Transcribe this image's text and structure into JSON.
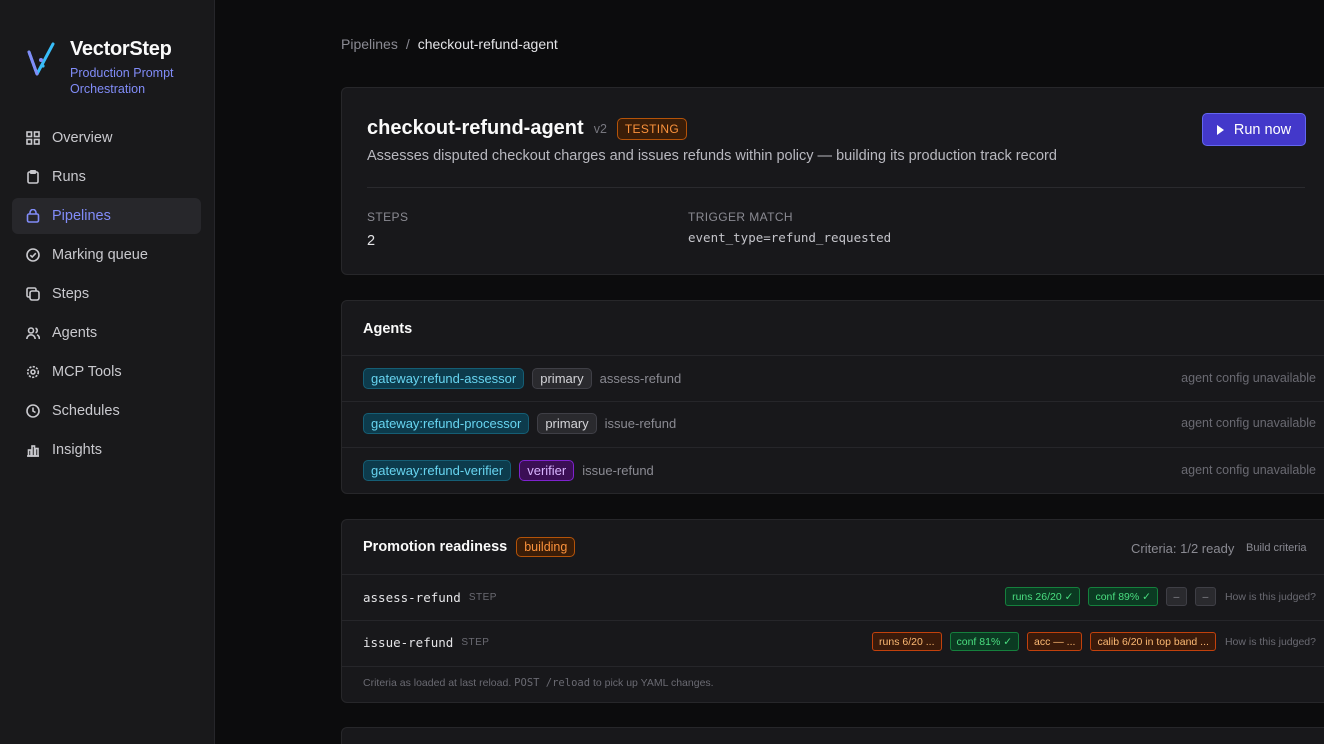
{
  "brand": {
    "name": "VectorStep",
    "tagline_line1": "Production Prompt",
    "tagline_line2": "Orchestration",
    "accent": "#818cf8"
  },
  "nav": [
    {
      "label": "Overview",
      "icon": "grid-icon"
    },
    {
      "label": "Runs",
      "icon": "clipboard-icon"
    },
    {
      "label": "Pipelines",
      "icon": "bag-icon",
      "active": true
    },
    {
      "label": "Marking queue",
      "icon": "check-circle-icon"
    },
    {
      "label": "Steps",
      "icon": "copy-icon"
    },
    {
      "label": "Agents",
      "icon": "users-icon"
    },
    {
      "label": "MCP Tools",
      "icon": "gear-icon"
    },
    {
      "label": "Schedules",
      "icon": "clock-icon"
    },
    {
      "label": "Insights",
      "icon": "bar-chart-icon"
    }
  ],
  "breadcrumb": {
    "parent": "Pipelines",
    "separator": "/",
    "current": "checkout-refund-agent"
  },
  "pipeline": {
    "name": "checkout-refund-agent",
    "version": "v2",
    "status": "TESTING",
    "description": "Assesses disputed checkout charges and issues refunds within policy — building its production track record",
    "run_label": "Run now",
    "steps_label": "STEPS",
    "steps_value": "2",
    "trigger_label": "TRIGGER MATCH",
    "trigger_value": "event_type=refund_requested"
  },
  "agents": {
    "title": "Agents",
    "rows": [
      {
        "gateway": "gateway:refund-assessor",
        "role": "primary",
        "step": "assess-refund",
        "status": "agent config unavailable"
      },
      {
        "gateway": "gateway:refund-processor",
        "role": "primary",
        "step": "issue-refund",
        "status": "agent config unavailable"
      },
      {
        "gateway": "gateway:refund-verifier",
        "role": "verifier",
        "step": "issue-refund",
        "status": "agent config unavailable"
      }
    ]
  },
  "promotion": {
    "title": "Promotion readiness",
    "status": "building",
    "criteria_ready": "Criteria: 1/2 ready",
    "build_criteria": "Build criteria",
    "how_label": "How is this judged?",
    "step_tag": "STEP",
    "steps": [
      {
        "name": "assess-refund",
        "pills": [
          "runs 26/20 ✓",
          "conf 89% ✓",
          "–",
          "–"
        ]
      },
      {
        "name": "issue-refund",
        "pills": [
          "runs 6/20 ...",
          "conf 81% ✓",
          "acc — ...",
          "calib 6/20 in top band ..."
        ]
      }
    ],
    "footnote_pre": "Criteria as loaded at last reload.",
    "footnote_code": "POST /reload",
    "footnote_post": "to pick up YAML changes."
  }
}
